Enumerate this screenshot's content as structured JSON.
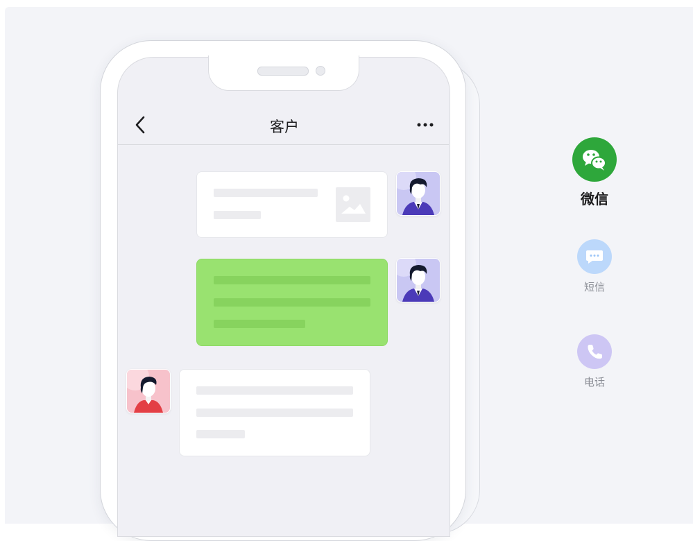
{
  "chat": {
    "title": "客户"
  },
  "channels": [
    {
      "label": "微信",
      "icon": "wechat-icon",
      "color": "#2ea73b",
      "active": true
    },
    {
      "label": "短信",
      "icon": "sms-icon",
      "color": "#bcd8fb",
      "active": false
    },
    {
      "label": "电话",
      "icon": "phone-icon",
      "color": "#cdc6f4",
      "active": false
    }
  ],
  "colors": {
    "background": "#f3f4f8",
    "screen": "#f0f0f5",
    "sent_bubble_green": "#99e270",
    "wechat_green": "#2ea73b"
  }
}
